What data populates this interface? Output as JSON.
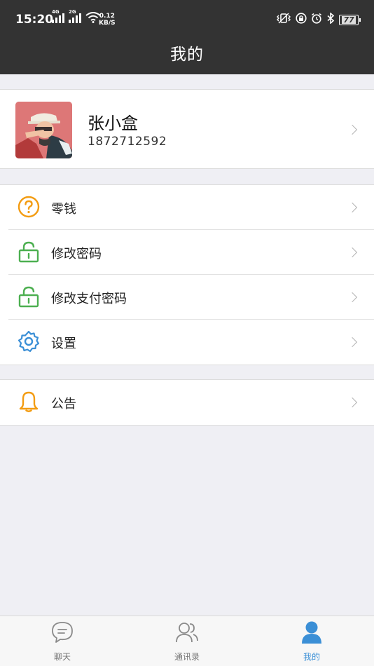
{
  "status_bar": {
    "time": "15:20",
    "network_1": "4G",
    "network_2": "2G",
    "speed_value": "0.12",
    "speed_unit": "KB/S",
    "battery": "77"
  },
  "header": {
    "title": "我的"
  },
  "profile": {
    "name": "张小盒",
    "phone": "1872712592"
  },
  "menu_groups": [
    {
      "items": [
        {
          "label": "零钱",
          "icon": "question-circle-icon",
          "color": "#f39c12"
        },
        {
          "label": "修改密码",
          "icon": "lock-icon",
          "color": "#4caf50"
        },
        {
          "label": "修改支付密码",
          "icon": "lock-icon",
          "color": "#4caf50"
        },
        {
          "label": "设置",
          "icon": "gear-icon",
          "color": "#3b8fd6"
        }
      ]
    },
    {
      "items": [
        {
          "label": "公告",
          "icon": "bell-icon",
          "color": "#f39c12"
        }
      ]
    }
  ],
  "tabbar": {
    "tabs": [
      {
        "label": "聊天",
        "icon": "chat-bubble-icon",
        "active": false
      },
      {
        "label": "通讯录",
        "icon": "contacts-icon",
        "active": false
      },
      {
        "label": "我的",
        "icon": "person-icon",
        "active": true
      }
    ],
    "active_color": "#3b8fd6",
    "inactive_color": "#777777"
  }
}
